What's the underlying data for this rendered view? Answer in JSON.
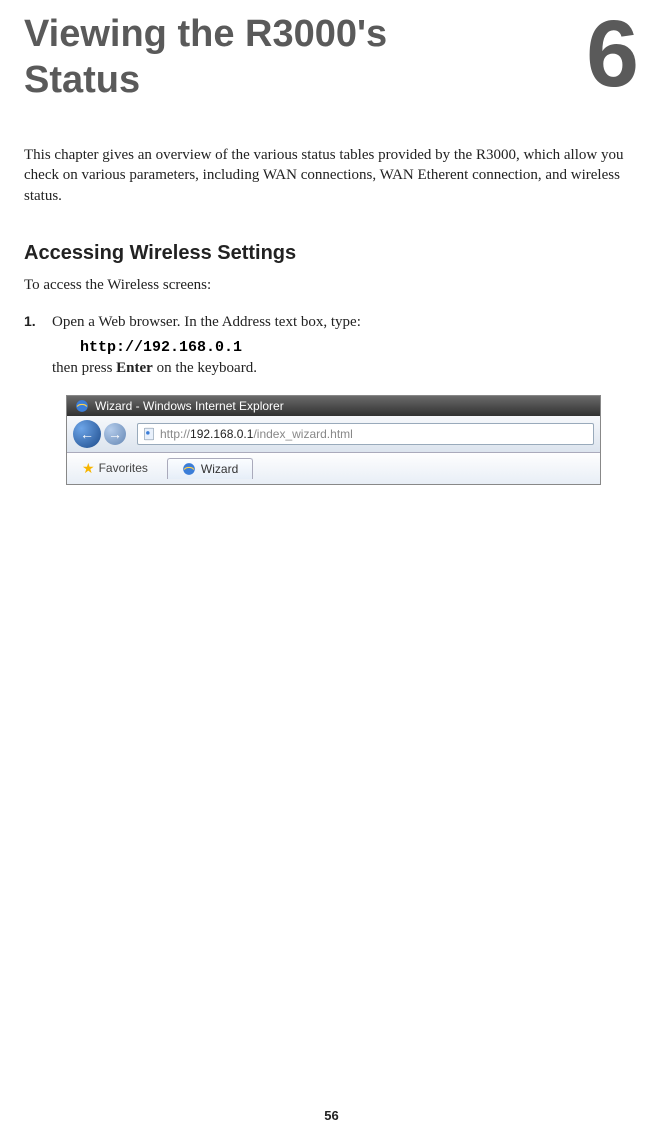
{
  "chapter": {
    "title": "Viewing the R3000's Status",
    "number": "6"
  },
  "intro": "This chapter gives an overview of the various status tables provided by the R3000, which allow you check on various parameters, including WAN connections, WAN Etherent connection, and wireless status.",
  "section": {
    "title": "Accessing Wireless Settings",
    "intro": "To access the Wireless screens:"
  },
  "step1": {
    "num": "1.",
    "text": "Open a Web browser. In the Address text box, type:",
    "url": "http://192.168.0.1",
    "then1": "then press ",
    "thenBold": "Enter",
    "then2": " on the keyboard."
  },
  "screenshot": {
    "windowTitle": "Wizard - Windows Internet Explorer",
    "urlPrefix": "http://",
    "urlBold": "192.168.0.1",
    "urlSuffix": "/index_wizard.html",
    "favorites": "Favorites",
    "tabLabel": "Wizard"
  },
  "pageNumber": "56"
}
